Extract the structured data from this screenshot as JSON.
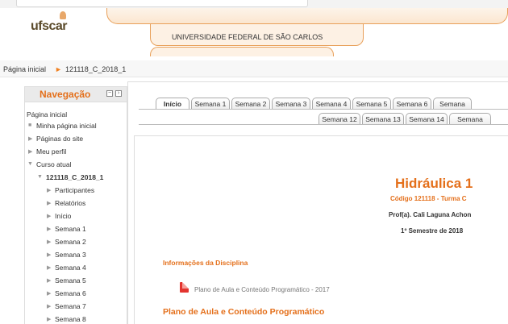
{
  "header": {
    "logo_text": "ufscar",
    "university": "UNIVERSIDADE FEDERAL DE SÃO CARLOS"
  },
  "breadcrumb": {
    "home": "Página inicial",
    "separator": "►",
    "course": "121118_C_2018_1"
  },
  "navigation": {
    "title": "Navegação",
    "items": [
      {
        "label": "Página inicial"
      },
      {
        "label": "Minha página inicial"
      },
      {
        "label": "Páginas do site"
      },
      {
        "label": "Meu perfil"
      },
      {
        "label": "Curso atual"
      },
      {
        "label": "121118_C_2018_1"
      },
      {
        "label": "Participantes"
      },
      {
        "label": "Relatórios"
      },
      {
        "label": "Início"
      },
      {
        "label": "Semana 1"
      },
      {
        "label": "Semana 2"
      },
      {
        "label": "Semana 3"
      },
      {
        "label": "Semana 4"
      },
      {
        "label": "Semana 5"
      },
      {
        "label": "Semana 6"
      },
      {
        "label": "Semana 7"
      },
      {
        "label": "Semana 8"
      }
    ]
  },
  "tabs": {
    "row1": [
      "Início",
      "Semana 1",
      "Semana 2",
      "Semana 3",
      "Semana 4",
      "Semana 5",
      "Semana 6",
      "Semana"
    ],
    "row2": [
      "Semana 12",
      "Semana 13",
      "Semana 14",
      "Semana"
    ]
  },
  "course": {
    "title": "Hidráulica 1",
    "code": "Código 121118 - Turma C",
    "professor": "Prof(a). Cali Laguna Achon",
    "semester": "1º Semestre de 2018"
  },
  "section": {
    "info_heading": "Informações da Disciplina",
    "pdf_link": "Plano de Aula e Conteúdo Programático - 2017",
    "plan_heading": "Plano de Aula e Conteúdo Programático"
  },
  "colors": {
    "accent": "#e46f1a",
    "pdf": "#e3342f"
  }
}
